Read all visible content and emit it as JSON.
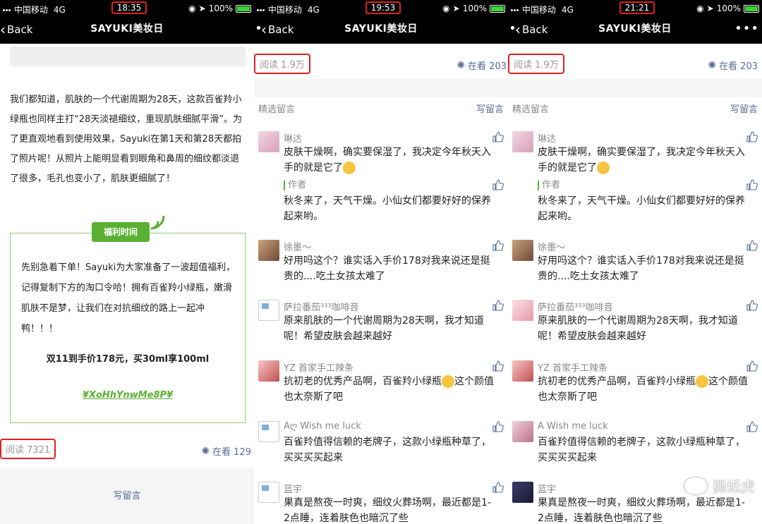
{
  "status": {
    "carrier": "中国移动",
    "network": "4G",
    "battery": "100%",
    "times": [
      "18:35",
      "19:53",
      "21:21"
    ]
  },
  "nav": {
    "back": "Back",
    "title": "SAYUKI美妆日",
    "more": "•••"
  },
  "article": {
    "paragraph": "我们都知道，肌肤的一个代谢周期为28天，这款百雀羚小绿瓶也同样主打“28天淡褪细纹，重现肌肤细腻平滑”。为了更直观地看到使用效果，Sayuki在第1天和第28天都拍了照片呢！从照片上能明显看到眼角和鼻周的细纹都淡退了很多，毛孔也变小了，肌肤更细腻了！",
    "welfare_tag": "福利时间",
    "welfare_text": "先别急着下单！Sayuki为大家准备了一波超值福利，记得复制下方的淘口令哈！拥有百雀羚小绿瓶，嫩滑肌肤不是梦，让我们在对抗细纹的路上一起冲鸭！！！",
    "welfare_price": "双11到手价178元，买30ml享100ml",
    "welfare_code": "¥XoHhYnwMe8P¥",
    "read_label": "阅读 7321",
    "watching_label": "在看 129",
    "write_comment": "写留言"
  },
  "comments_page": {
    "read_label": "阅读 1.9万",
    "watching_label": "在看 203",
    "selected_header": "精选留言",
    "write_comment": "写留言",
    "author_label": "作者"
  },
  "comments": [
    {
      "name": "琳达",
      "text": "皮肤干燥啊，确实要保湿了，我决定今年秋天入手的就是它了",
      "reply": "秋冬来了，天气干燥。小仙女们都要好好的保养起来哟。"
    },
    {
      "name": "徐墨～",
      "text": "好用吗这个？谁实话入手价178对我来说还是挺贵的....吃土女孩太难了"
    },
    {
      "name": "萨拉番茄³³³咖啡音",
      "text": "原来肌肤的一个代谢周期为28天啊，我才知道呢！希望皮肤会越来越好"
    },
    {
      "name": "YZ 首家手工辣条",
      "text": "抗初老的优秀产品啊，百雀羚小绿瓶",
      "text_after": "这个颜值也太奈斯了吧"
    },
    {
      "name_p2": "Aღ Wish me luck",
      "name_p3": "A   Wish me luck",
      "text": "百雀羚值得信赖的老牌子，这款小绿瓶种草了，买买买买起来"
    },
    {
      "name": "蓝宇",
      "text": "果真是熬夜一时爽，细纹火葬场啊，最近都是1-2点睡，连着肤色也暗沉了些"
    }
  ],
  "watermark": "撕纸虎",
  "colors": {
    "link": "#576b95",
    "accent_green": "#5ab033",
    "highlight_red": "#e02020"
  }
}
